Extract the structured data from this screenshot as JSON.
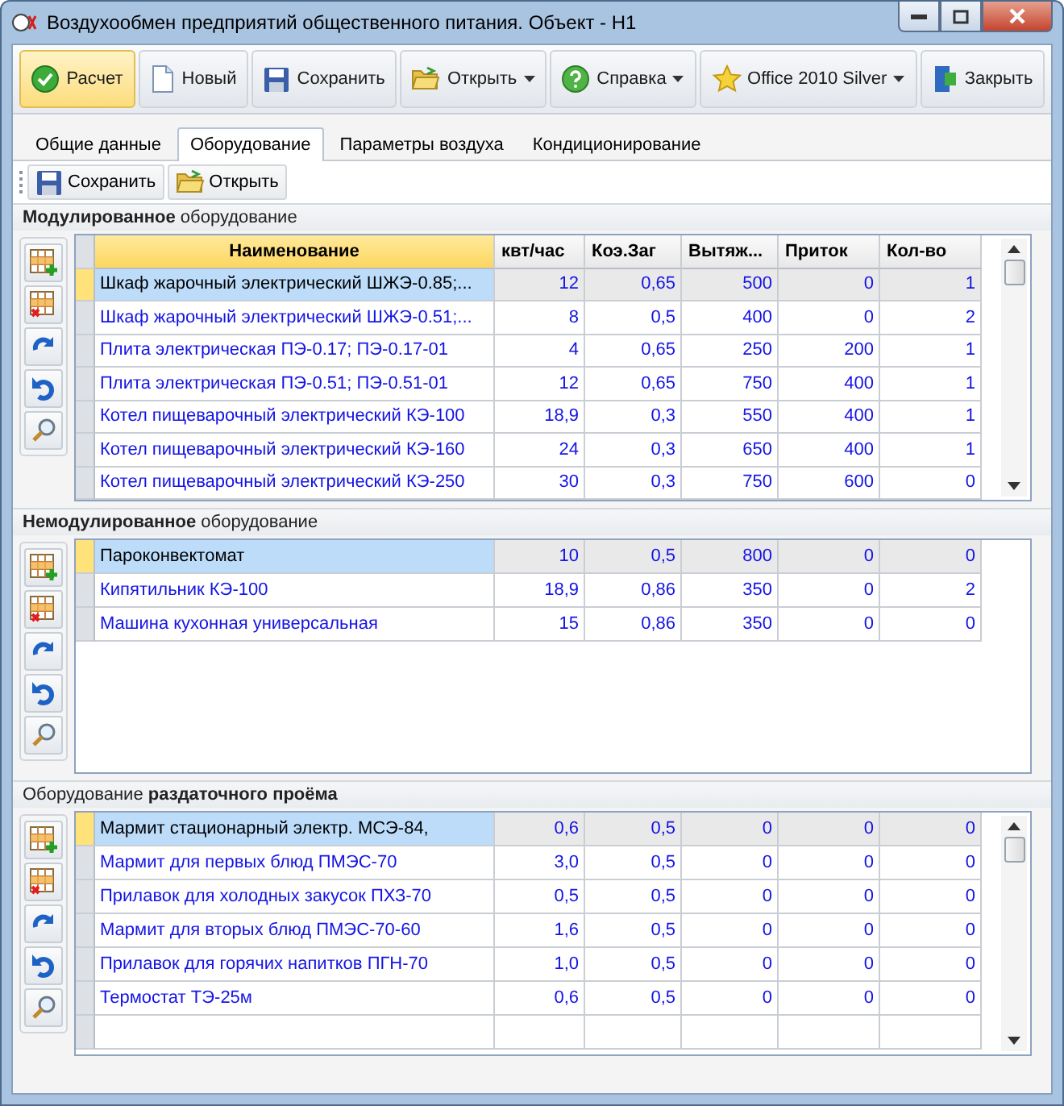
{
  "window": {
    "title": "Воздухообмен предприятий общественного питания. Объект - Н1"
  },
  "toolbar": [
    {
      "kind": "calc",
      "label": "Расчет",
      "highlighted": true,
      "dropdown": false
    },
    {
      "kind": "new",
      "label": "Новый",
      "highlighted": false,
      "dropdown": false
    },
    {
      "kind": "save",
      "label": "Сохранить",
      "highlighted": false,
      "dropdown": false
    },
    {
      "kind": "open",
      "label": "Открыть",
      "highlighted": false,
      "dropdown": true
    },
    {
      "kind": "help",
      "label": "Справка",
      "highlighted": false,
      "dropdown": true
    },
    {
      "kind": "theme",
      "label": "Office 2010 Silver",
      "highlighted": false,
      "dropdown": true
    },
    {
      "kind": "close",
      "label": "Закрыть",
      "highlighted": false,
      "dropdown": false
    }
  ],
  "tabs": [
    {
      "label": "Общие данные",
      "selected": false
    },
    {
      "label": "Оборудование",
      "selected": true
    },
    {
      "label": "Параметры воздуха",
      "selected": false
    },
    {
      "label": "Кондиционирование",
      "selected": false
    }
  ],
  "sub_toolbar": [
    {
      "kind": "save",
      "label": "Сохранить"
    },
    {
      "kind": "open",
      "label": "Открыть"
    }
  ],
  "sections": [
    {
      "title": "**Модулированное** оборудование",
      "scrollbar": true,
      "columns": [
        "Наименование",
        "квт/час",
        "Коэ.Заг",
        "Вытяж...",
        "Приток",
        "Кол-во"
      ],
      "rows": [
        {
          "selected": true,
          "cells": [
            "Шкаф жарочный электрический ШЖЭ-0.85;...",
            "12",
            "0,65",
            "500",
            "0",
            "1"
          ]
        },
        {
          "selected": false,
          "cells": [
            "Шкаф жарочный электрический ШЖЭ-0.51;...",
            "8",
            "0,5",
            "400",
            "0",
            "2"
          ]
        },
        {
          "selected": false,
          "cells": [
            "Плита электрическая ПЭ-0.17; ПЭ-0.17-01",
            "4",
            "0,65",
            "250",
            "200",
            "1"
          ]
        },
        {
          "selected": false,
          "cells": [
            "Плита электрическая ПЭ-0.51; ПЭ-0.51-01",
            "12",
            "0,65",
            "750",
            "400",
            "1"
          ]
        },
        {
          "selected": false,
          "cells": [
            "Котел пищеварочный электрический  КЭ-100",
            "18,9",
            "0,3",
            "550",
            "400",
            "1"
          ]
        },
        {
          "selected": false,
          "cells": [
            "Котел пищеварочный электрический  КЭ-160",
            "24",
            "0,3",
            "650",
            "400",
            "1"
          ]
        },
        {
          "selected": false,
          "cells": [
            "Котел пищеварочный электрический  КЭ-250",
            "30",
            "0,3",
            "750",
            "600",
            "0"
          ]
        }
      ]
    },
    {
      "title": "**Немодулированное** оборудование",
      "scrollbar": false,
      "rows": [
        {
          "selected": true,
          "cells": [
            "Пароконвектомат",
            "10",
            "0,5",
            "800",
            "0",
            "0"
          ]
        },
        {
          "selected": false,
          "cells": [
            "Кипятильник КЭ-100",
            "18,9",
            "0,86",
            "350",
            "0",
            "2"
          ]
        },
        {
          "selected": false,
          "cells": [
            "Машина кухонная универсальная",
            "15",
            "0,86",
            "350",
            "0",
            "0"
          ]
        }
      ]
    },
    {
      "title": "Оборудование **раздаточного проёма**",
      "scrollbar": true,
      "rows": [
        {
          "selected": true,
          "cells": [
            "Мармит стационарный электр. МСЭ-84,",
            "0,6",
            "0,5",
            "0",
            "0",
            "0"
          ]
        },
        {
          "selected": false,
          "cells": [
            "Мармит для первых блюд ПМЭС-70",
            "3,0",
            "0,5",
            "0",
            "0",
            "0"
          ]
        },
        {
          "selected": false,
          "cells": [
            "Прилавок для холодных закусок ПХЗ-70",
            "0,5",
            "0,5",
            "0",
            "0",
            "0"
          ]
        },
        {
          "selected": false,
          "cells": [
            "Мармит для вторых блюд ПМЭС-70-60",
            "1,6",
            "0,5",
            "0",
            "0",
            "0"
          ]
        },
        {
          "selected": false,
          "cells": [
            "Прилавок для горячих напитков ПГН-70",
            "1,0",
            "0,5",
            "0",
            "0",
            "0"
          ]
        },
        {
          "selected": false,
          "cells": [
            "Термостат ТЭ-25м",
            "0,6",
            "0,5",
            "0",
            "0",
            "0"
          ]
        }
      ]
    }
  ]
}
